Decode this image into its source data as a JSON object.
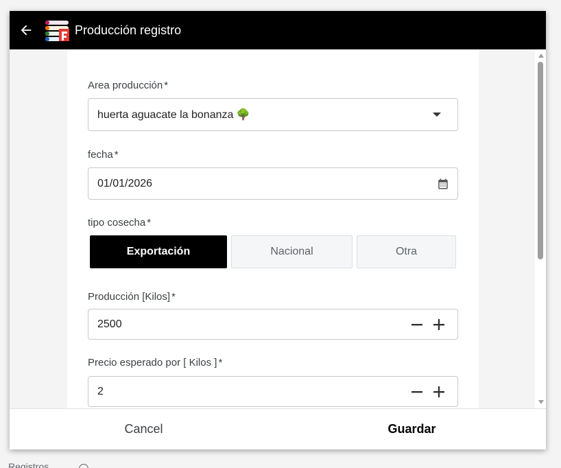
{
  "dialog": {
    "title": "Producción registro",
    "back_icon": "arrow-left-icon",
    "logo_icon": "app-logo-icon"
  },
  "form": {
    "area": {
      "label": "Area producción",
      "required": "*",
      "value": "huerta aguacate la bonanza 🌳",
      "icon": "chevron-down-icon"
    },
    "fecha": {
      "label": "fecha",
      "required": "*",
      "value": "01/01/2026",
      "icon": "calendar-icon"
    },
    "tipo": {
      "label": "tipo cosecha",
      "required": "*",
      "options": [
        "Exportación",
        "Nacional",
        "Otra"
      ],
      "selected": "Exportación"
    },
    "produccion": {
      "label": "Producción [Kilos]",
      "required": "*",
      "value": "2500"
    },
    "precio": {
      "label": "Precio esperado por [ Kilos ]",
      "required": "*",
      "value": "2"
    }
  },
  "footer": {
    "cancel_label": "Cancel",
    "save_label": "Guardar"
  },
  "backdrop": {
    "partial_label": "Registros"
  },
  "colors": {
    "titlebar": "#000000",
    "selected_segment": "#000000",
    "panel_bg": "#f4f4f4"
  }
}
